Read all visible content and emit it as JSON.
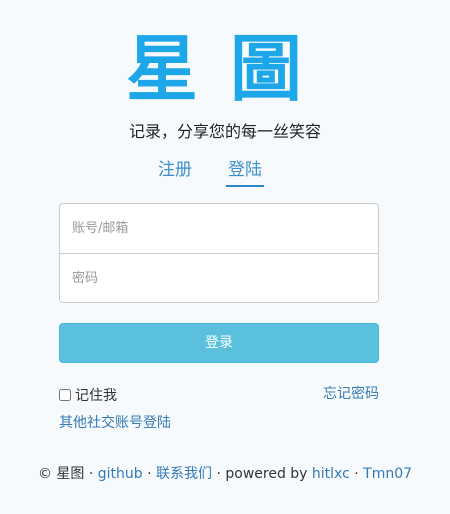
{
  "logo": {
    "char1": "星",
    "char2": "圖"
  },
  "slogan": "记录，分享您的每一丝笑容",
  "tabs": [
    {
      "label": "注册",
      "active": false
    },
    {
      "label": "登陆",
      "active": true
    }
  ],
  "form": {
    "account_placeholder": "账号/邮箱",
    "account_value": "",
    "password_placeholder": "密码",
    "password_value": "",
    "login_label": "登录",
    "remember_label": "记住我",
    "remember_checked": false,
    "forgot_label": "忘记密码",
    "social_label": "其他社交账号登陆"
  },
  "footer": {
    "copyright": "© 星图",
    "sep1": " · ",
    "github": "github",
    "sep2": " · ",
    "contact": "联系我们",
    "powered": " · powered by ",
    "author1": "hitlxc",
    "sep3": " · ",
    "author2": "Tmn07"
  },
  "colors": {
    "accent": "#1ea7e8",
    "link": "#337ab7",
    "button": "#5bc0de",
    "background": "#f7fafc"
  }
}
